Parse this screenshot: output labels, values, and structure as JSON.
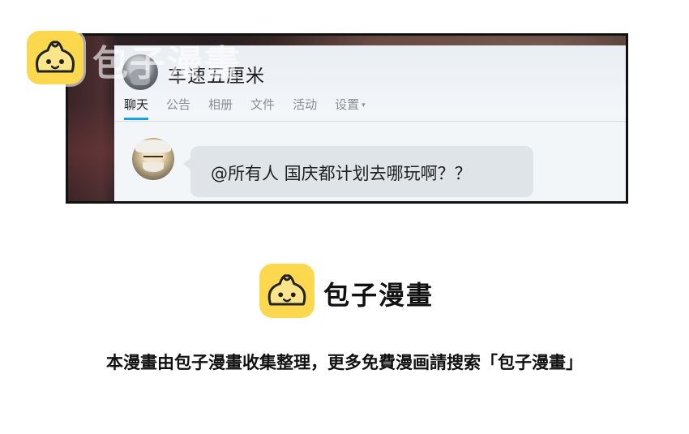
{
  "chat": {
    "group_name": "车速五厘米",
    "tabs": [
      {
        "label": "聊天",
        "active": true
      },
      {
        "label": "公告"
      },
      {
        "label": "相册"
      },
      {
        "label": "文件"
      },
      {
        "label": "活动"
      },
      {
        "label": "设置",
        "caret": "▾"
      }
    ],
    "message": "@所有人 国庆都计划去哪玩啊？？"
  },
  "watermark": {
    "text": "包子漫畫",
    "logo_icon": "bun-logo-icon"
  },
  "brand": {
    "name": "包子漫畫",
    "logo_icon": "bun-logo-icon",
    "logo_color": "#fcd84e",
    "notice": "本漫畫由包子漫畫收集整理，更多免費漫画請搜索「包子漫畫」"
  },
  "colors": {
    "active_tab_underline": "#17a2e6",
    "bubble_background": "#dfe4e9"
  }
}
